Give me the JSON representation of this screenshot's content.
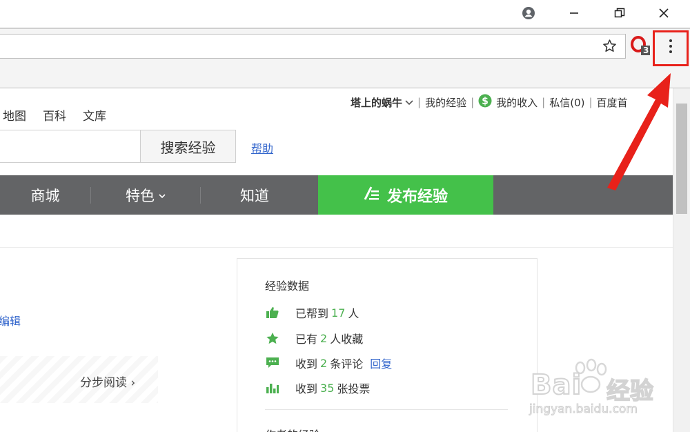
{
  "browser": {
    "bookmark_icon": "star-outline-icon",
    "extension_icon": "opera-extension-icon",
    "extension_badge": "3",
    "menu_icon": "vertical-dots-menu-icon",
    "window_controls": [
      "account-icon",
      "minimize-icon",
      "restore-icon",
      "close-icon"
    ]
  },
  "page": {
    "userbar": {
      "username": "塔上的蜗牛",
      "my_experience": "我的经验",
      "my_income": "我的收入",
      "messages": "私信(0)",
      "baidu_home": "百度首"
    },
    "topnav": [
      "地图",
      "百科",
      "文库"
    ],
    "search": {
      "button": "搜索经验",
      "help": "帮助"
    },
    "nav": {
      "mall": "商城",
      "featured": "特色",
      "zhidao": "知道",
      "publish": "发布经验"
    },
    "edit_link": "编辑",
    "step_read": "分步阅读 ›",
    "stats": {
      "title": "经验数据",
      "helped_prefix": "已帮到",
      "helped_count": "17",
      "helped_suffix": "人",
      "fav_prefix": "已有",
      "fav_count": "2",
      "fav_suffix": "人收藏",
      "comments_prefix": "收到",
      "comments_count": "2",
      "comments_suffix": "条评论",
      "reply": "回复",
      "votes_prefix": "收到",
      "votes_count": "35",
      "votes_suffix": "张投票",
      "author_section": "作者的经验"
    },
    "watermark": {
      "brand": "Bai",
      "brand2": "经验",
      "url": "jingyan.baidu.com"
    }
  },
  "colors": {
    "nav_bg": "#636466",
    "publish_green": "#44c14a",
    "link_blue": "#3366cc",
    "stat_green": "#4cb050",
    "annotation_red": "#e8211a"
  }
}
